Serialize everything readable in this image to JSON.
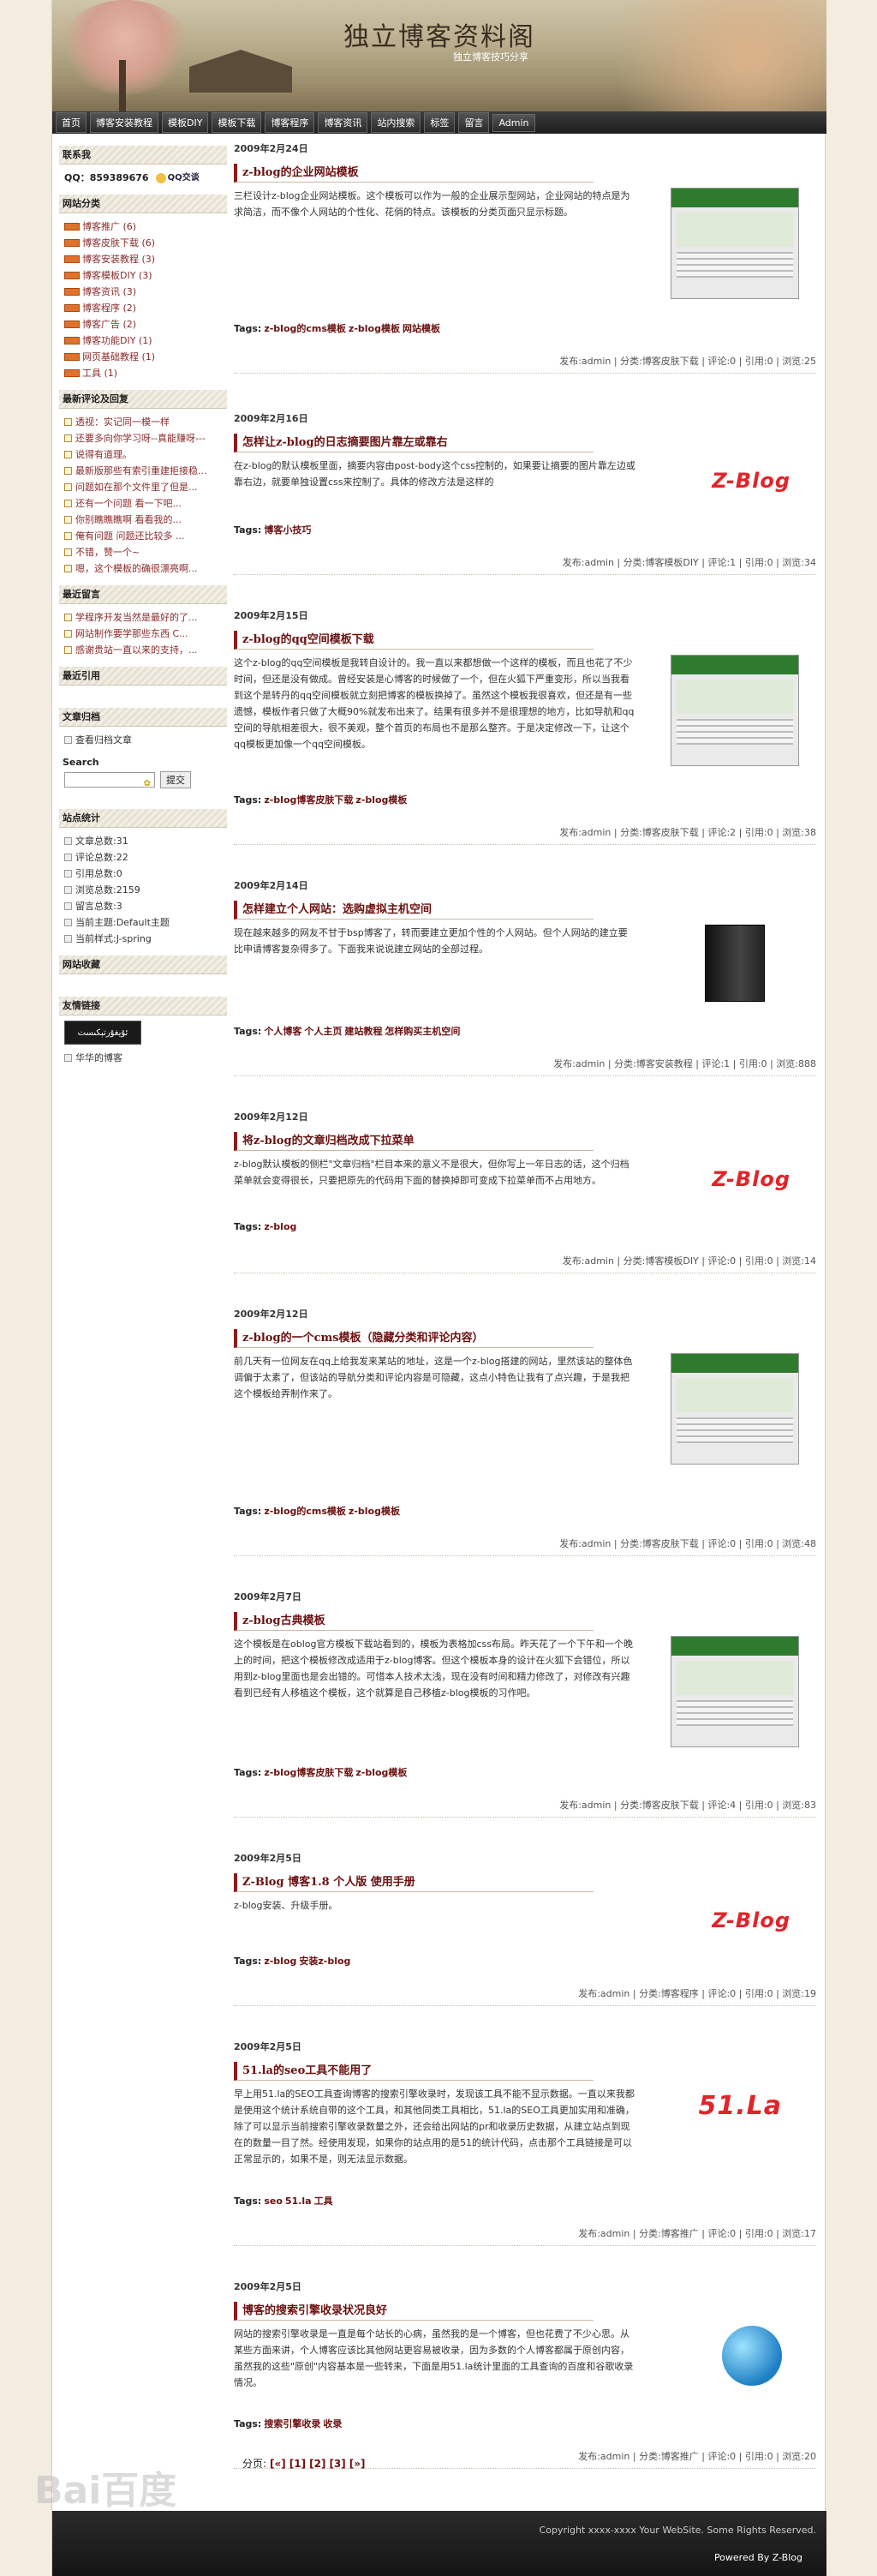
{
  "site": {
    "title": "独立博客资料阁",
    "subtitle": "独立博客技巧分享"
  },
  "nav": [
    "首页",
    "博客安装教程",
    "模板DIY",
    "模板下载",
    "博客程序",
    "博客资讯",
    "站内搜索",
    "标签",
    "留言",
    "Admin"
  ],
  "sidebar": {
    "contact_title": "联系我",
    "qq_label": "QQ：859389676",
    "qq_button": "QQ交谈",
    "categories_title": "网站分类",
    "categories": [
      "博客推广 (6)",
      "博客皮肤下载 (6)",
      "博客安装教程 (3)",
      "博客模板DIY (3)",
      "博客资讯 (3)",
      "博客程序 (2)",
      "博客广告 (2)",
      "博客功能DIY (1)",
      "网页基础教程 (1)",
      "工具 (1)"
    ],
    "comments_title": "最新评论及回复",
    "comments": [
      "透视：实记同一模一样",
      "还要多向你学习呀--真能赚呀---",
      "说得有道理。",
      "最新版那些有索引重建拒接稳...",
      "问题如在那个文件里了但是...",
      "还有一个问题 看一下吧...",
      "你别瞧瞧瞧啊 看看我的...",
      "俺有问题 问题还比较多 ...",
      "不错，赞一个~",
      "嗯，这个模板的确很漂亮啊..."
    ],
    "guestbook_title": "最近留言",
    "guestbook": [
      "学程序开发当然是最好的了...",
      "网站制作要学那些东西 C...",
      "感谢贵站一直以来的支持，..."
    ],
    "cites_title": "最近引用",
    "archive_title": "文章归档",
    "archive_link": "查看归档文章",
    "search_title": "Search",
    "search_button": "提交",
    "stats_title": "站点统计",
    "stats": [
      "文章总数:31",
      "评论总数:22",
      "引用总数:0",
      "浏览总数:2159",
      "留言总数:3",
      "当前主题:Default主题",
      "当前样式:J-spring"
    ],
    "favorites_title": "网站收藏",
    "links_title": "友情链接",
    "link_logo": "ئۇيغۇرتېكىست",
    "link_text": "华华的博客"
  },
  "posts": [
    {
      "date": "2009年2月24日",
      "title": "z-blog的企业网站模板",
      "body": "三栏设计z-blog企业网站模板。这个模板可以作为一般的企业展示型网站，企业网站的特点是为求简洁，而不像个人网站的个性化、花俏的特点。该模板的分类页面只显示标题。",
      "tags_label": "Tags:",
      "tags": [
        "z-blog的cms模板",
        "z-blog模板",
        "网站模板"
      ],
      "meta": "发布:admin | 分类:博客皮肤下载 | 评论:0 | 引用:0 | 浏览:25",
      "image": "thumb"
    },
    {
      "date": "2009年2月16日",
      "title": "怎样让z-blog的日志摘要图片靠左或靠右",
      "body": "在z-blog的默认模板里面，摘要内容由post-body这个css控制的，如果要让摘要的图片靠左边或靠右边，就要单独设置css来控制了。具体的修改方法是这样的",
      "tags_label": "Tags:",
      "tags": [
        "博客小技巧"
      ],
      "meta": "发布:admin | 分类:博客模板DIY | 评论:1 | 引用:0 | 浏览:34",
      "image": "zblog",
      "image_text": "Z-Blog"
    },
    {
      "date": "2009年2月15日",
      "title": "z-blog的qq空间模板下载",
      "body": "这个z-blog的qq空间模板是我转自设计的。我一直以来都想做一个这样的模板，而且也花了不少时间，但还是没有做成。曾经安装是心博客的时候做了一个，但在火狐下严重变形，所以当我看到这个是转丹的qq空间模板就立刻把博客的模板换掉了。虽然这个模板我很喜欢，但还是有一些遗憾，模板作者只做了大概90%就发布出来了。结果有很多并不是很理想的地方，比如导航和qq空间的导航相差很大，很不美观，整个首页的布局也不是那么整齐。于是决定修改一下，让这个qq模板更加像一个qq空间模板。",
      "tags_label": "Tags:",
      "tags": [
        "z-blog博客皮肤下载",
        "z-blog模板"
      ],
      "meta": "发布:admin | 分类:博客皮肤下载 | 评论:2 | 引用:0 | 浏览:38",
      "image": "thumb"
    },
    {
      "date": "2009年2月14日",
      "title": "怎样建立个人网站：选购虚拟主机空间",
      "body": "现在越来越多的网友不甘于bsp博客了，转而要建立更加个性的个人网站。但个人网站的建立要比申请博客复杂得多了。下面我来说说建立网站的全部过程。",
      "tags_label": "Tags:",
      "tags": [
        "个人博客",
        "个人主页",
        "建站教程",
        "怎样购买主机空间"
      ],
      "meta": "发布:admin | 分类:博客安装教程 | 评论:1 | 引用:0 | 浏览:888",
      "image": "server"
    },
    {
      "date": "2009年2月12日",
      "title": "将z-blog的文章归档改成下拉菜单",
      "body": "z-blog默认模板的侧栏\"文章归档\"栏目本来的意义不是很大，但你写上一年日志的话，这个归档菜单就会变得很长，只要把原先的代码用下面的替换掉即可变成下拉菜单而不占用地方。",
      "tags_label": "Tags:",
      "tags": [
        "z-blog"
      ],
      "meta": "发布:admin | 分类:博客模板DIY | 评论:0 | 引用:0 | 浏览:14",
      "image": "zblog",
      "image_text": "Z-Blog"
    },
    {
      "date": "2009年2月12日",
      "title": "z-blog的一个cms模板（隐藏分类和评论内容）",
      "body": "前几天有一位网友在qq上给我发来某站的地址，这是一个z-blog搭建的网站，里然该站的整体色调偏于太素了，但该站的导航分类和评论内容是可隐藏，这点小特色让我有了点兴趣，于是我把这个模板给弄制作来了。",
      "tags_label": "Tags:",
      "tags": [
        "z-blog的cms模板",
        "z-blog模板"
      ],
      "meta": "发布:admin | 分类:博客皮肤下载 | 评论:0 | 引用:0 | 浏览:48",
      "image": "thumb"
    },
    {
      "date": "2009年2月7日",
      "title": "z-blog古典模板",
      "body": "这个模板是在oblog官方模板下载站看到的，模板为表格加css布局。昨天花了一个下午和一个晚上的时间，把这个模板修改成适用于z-blog博客。但这个模板本身的设计在火狐下会错位，所以用到z-blog里面也是会出错的。可惜本人技术太浅，现在没有时间和精力修改了，对修改有兴趣看到已经有人移植这个模板，这个就算是自己移植z-blog模板的习作吧。",
      "tags_label": "Tags:",
      "tags": [
        "z-blog博客皮肤下载",
        "z-blog模板"
      ],
      "meta": "发布:admin | 分类:博客皮肤下载 | 评论:4 | 引用:0 | 浏览:83",
      "image": "thumb"
    },
    {
      "date": "2009年2月5日",
      "title": "Z-Blog 博客1.8 个人版 使用手册",
      "body": "z-blog安装、升级手册。",
      "tags_label": "Tags:",
      "tags": [
        "z-blog",
        "安装z-blog"
      ],
      "meta": "发布:admin | 分类:博客程序 | 评论:0 | 引用:0 | 浏览:19",
      "image": "zblog",
      "image_text": "Z-Blog"
    },
    {
      "date": "2009年2月5日",
      "title": "51.la的seo工具不能用了",
      "body": "早上用51.la的SEO工具查询博客的搜索引擎收录时，发现该工具不能不显示数据。一直以来我都是使用这个统计系统自带的这个工具，和其他同类工具相比，51.la的SEO工具更加实用和准确，除了可以显示当前搜索引擎收录数量之外，还会给出网站的pr和收录历史数据，从建立站点到现在的数量一目了然。经使用发现，如果你的站点用的是51的统计代码，点击那个工具链接是可以正常显示的，如果不是，则无法显示数据。",
      "tags_label": "Tags:",
      "tags": [
        "seo",
        "51.la",
        "工具"
      ],
      "meta": "发布:admin | 分类:博客推广 | 评论:0 | 引用:0 | 浏览:17",
      "image": "la51",
      "image_text": "51.La"
    },
    {
      "date": "2009年2月5日",
      "title": "博客的搜索引擎收录状况良好",
      "body": "网站的搜索引擎收录是一直是每个站长的心病，虽然我的是一个博客，但也花费了不少心思。从某些方面来讲，个人博客应该比其他网站更容易被收录，因为多数的个人博客都属于原创内容，虽然我的这些\"原创\"内容基本是一些转来，下面是用51.la统计里面的工具查询的百度和谷歌收录情况。",
      "tags_label": "Tags:",
      "tags": [
        "搜索引擎收录",
        "收录"
      ],
      "meta": "发布:admin | 分类:博客推广 | 评论:0 | 引用:0 | 浏览:20",
      "image": "globe"
    }
  ],
  "pager": {
    "label": "分页:",
    "items": [
      "[«]",
      "[1]",
      "[2]",
      "[3]",
      "[»]"
    ]
  },
  "footer": {
    "copyright": "Copyright xxxx-xxxx Your WebSite. Some Rights Reserved.",
    "powered": "Powered By Z-Blog"
  },
  "watermark": "Bai百度"
}
